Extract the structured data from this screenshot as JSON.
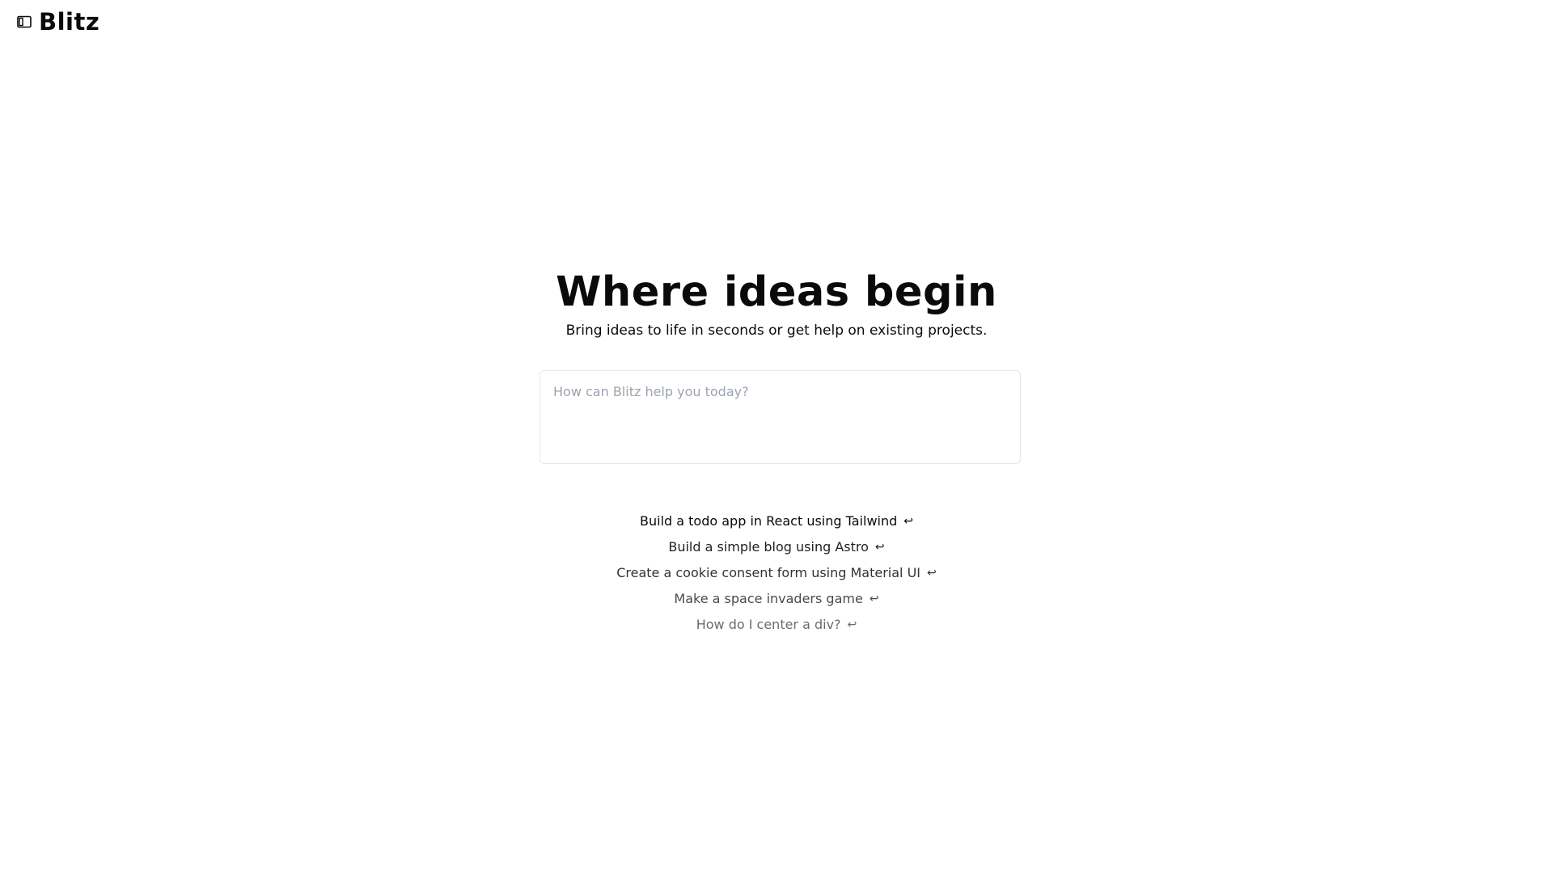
{
  "header": {
    "brand": "Blitz",
    "sidebar_toggle_icon": "sidebar-toggle-icon"
  },
  "hero": {
    "title": "Where ideas begin",
    "subtitle": "Bring ideas to life in seconds or get help on existing projects."
  },
  "prompt": {
    "placeholder": "How can Blitz help you today?",
    "value": ""
  },
  "suggestions": [
    {
      "label": "Build a todo app in React using Tailwind",
      "icon": "enter-icon",
      "color": "#0a0a0a"
    },
    {
      "label": "Build a simple blog using Astro",
      "icon": "enter-icon",
      "color": "#1f1f1f"
    },
    {
      "label": "Create a cookie consent form using Material UI",
      "icon": "enter-icon",
      "color": "#333333"
    },
    {
      "label": "Make a space invaders game",
      "icon": "enter-icon",
      "color": "#4b4b4b"
    },
    {
      "label": "How do I center a div?",
      "icon": "enter-icon",
      "color": "#6b6b6b"
    }
  ],
  "enter_glyph": "↩"
}
